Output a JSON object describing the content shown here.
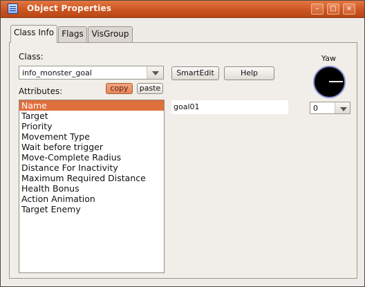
{
  "window": {
    "title": "Object Properties",
    "controls": [
      "minimize-icon",
      "maximize-icon",
      "close-icon"
    ]
  },
  "tabs": [
    {
      "label": "Class Info",
      "active": true
    },
    {
      "label": "Flags",
      "active": false
    },
    {
      "label": "VisGroup",
      "active": false
    }
  ],
  "class_section": {
    "label": "Class:",
    "value": "info_monster_goal"
  },
  "buttons": {
    "smartedit": "SmartEdit",
    "help": "Help",
    "copy": "copy",
    "paste": "paste"
  },
  "attributes": {
    "label": "Attributes:",
    "selected_index": 0,
    "items": [
      "Name",
      "Target",
      "Priority",
      "Movement Type",
      "Wait before trigger",
      "Move-Complete Radius",
      "Distance For Inactivity",
      "Maximum Required Distance",
      "Health Bonus",
      "Action Animation",
      "Target Enemy"
    ]
  },
  "value_field": {
    "value": "goal01"
  },
  "yaw": {
    "label": "Yaw",
    "value": "0"
  },
  "colors": {
    "titlebar": "#c95220",
    "selection": "#df6f3c",
    "dial_ring": "#8790d6"
  }
}
